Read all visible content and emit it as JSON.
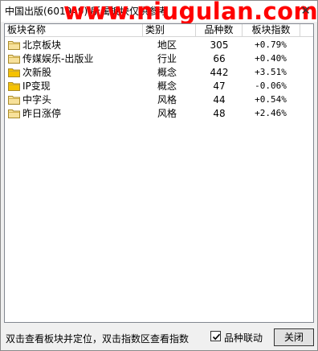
{
  "window": {
    "title": "中国出版(601949) 所属板块仅供参考",
    "watermark": "www.niugulan.com",
    "close_glyph": "✕"
  },
  "table": {
    "columns": [
      "板块名称",
      "类别",
      "品种数",
      "板块指数"
    ],
    "rows": [
      {
        "name": "北京板块",
        "category": "地区",
        "count": "305",
        "index": "+0.79%",
        "icon": "folder-icon",
        "icon_color": "#f7e19b"
      },
      {
        "name": "传媒娱乐-出版业",
        "category": "行业",
        "count": "66",
        "index": "+0.40%",
        "icon": "folder-icon",
        "icon_color": "#f7e19b"
      },
      {
        "name": "次新股",
        "category": "概念",
        "count": "442",
        "index": "+3.51%",
        "icon": "folder-icon",
        "icon_color": "#f5c200"
      },
      {
        "name": "IP变现",
        "category": "概念",
        "count": "47",
        "index": "-0.06%",
        "icon": "folder-icon",
        "icon_color": "#f5c200"
      },
      {
        "name": "中字头",
        "category": "风格",
        "count": "44",
        "index": "+0.54%",
        "icon": "folder-icon",
        "icon_color": "#f7e19b"
      },
      {
        "name": "昨日涨停",
        "category": "风格",
        "count": "48",
        "index": "+2.46%",
        "icon": "folder-icon",
        "icon_color": "#f7e19b"
      }
    ]
  },
  "status": {
    "hint": "双击查看板块并定位，双击指数区查看指数",
    "linkage_label": "品种联动",
    "linkage_checked": true,
    "close_button": "关闭"
  },
  "colors": {
    "watermark": "#ff0000",
    "folder_light": "#f7e19b",
    "folder_dark": "#f5c200"
  }
}
